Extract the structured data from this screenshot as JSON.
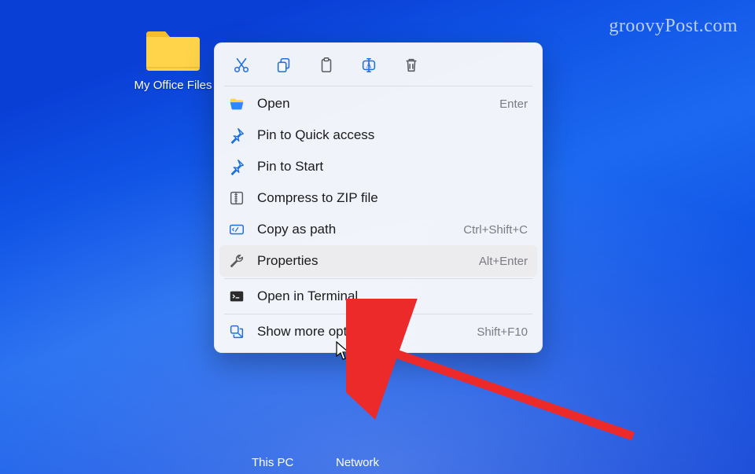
{
  "watermark": "groovyPost.com",
  "desktop_icon": {
    "label": "My Office Files"
  },
  "lower_labels": {
    "this_pc": "This PC",
    "network": "Network"
  },
  "toolbar": {
    "cut": "cut",
    "copy": "copy",
    "paste": "paste",
    "rename": "rename",
    "delete": "delete"
  },
  "menu": {
    "open": {
      "label": "Open",
      "shortcut": "Enter"
    },
    "pin_quick": {
      "label": "Pin to Quick access",
      "shortcut": ""
    },
    "pin_start": {
      "label": "Pin to Start",
      "shortcut": ""
    },
    "compress": {
      "label": "Compress to ZIP file",
      "shortcut": ""
    },
    "copy_path": {
      "label": "Copy as path",
      "shortcut": "Ctrl+Shift+C"
    },
    "properties": {
      "label": "Properties",
      "shortcut": "Alt+Enter"
    },
    "terminal": {
      "label": "Open in Terminal",
      "shortcut": ""
    },
    "more": {
      "label": "Show more options",
      "shortcut": "Shift+F10"
    }
  },
  "colors": {
    "icon_blue": "#1f6fe0",
    "icon_gray": "#5a5c60",
    "hover": "#ececee",
    "arrow": "#ec2a2a"
  }
}
